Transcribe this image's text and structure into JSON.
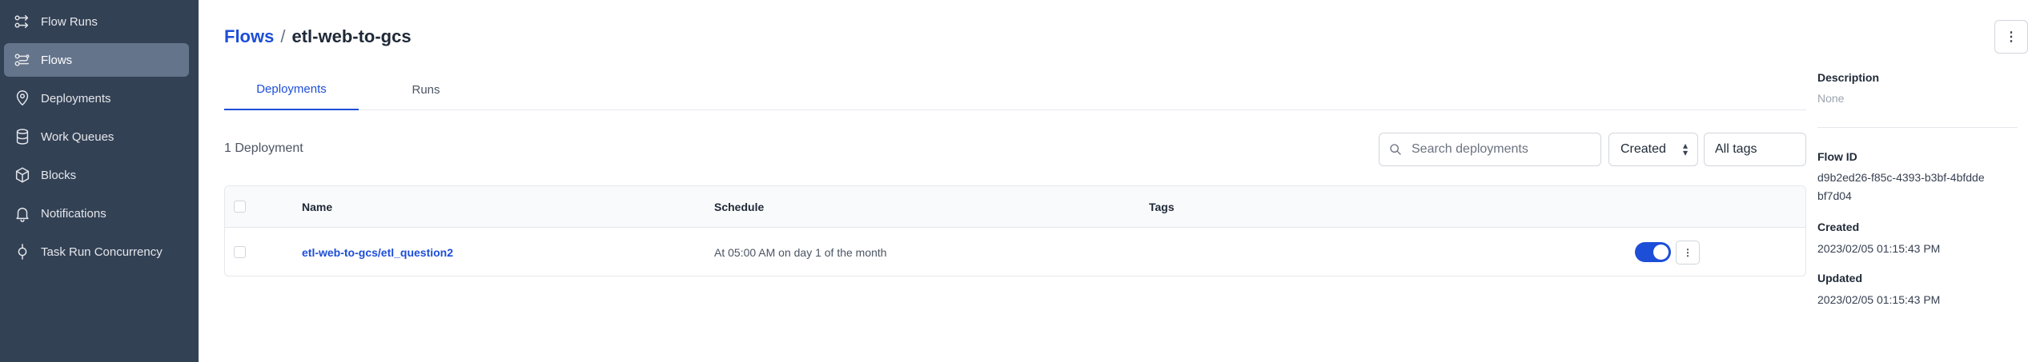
{
  "sidebar": {
    "items": [
      {
        "label": "Flow Runs",
        "icon": "flow-runs-icon",
        "active": false
      },
      {
        "label": "Flows",
        "icon": "flows-icon",
        "active": true
      },
      {
        "label": "Deployments",
        "icon": "map-pin-icon",
        "active": false
      },
      {
        "label": "Work Queues",
        "icon": "database-icon",
        "active": false
      },
      {
        "label": "Blocks",
        "icon": "cube-icon",
        "active": false
      },
      {
        "label": "Notifications",
        "icon": "bell-icon",
        "active": false
      },
      {
        "label": "Task Run Concurrency",
        "icon": "concurrency-icon",
        "active": false
      }
    ]
  },
  "header": {
    "breadcrumb_root": "Flows",
    "separator": "/",
    "flow_name": "etl-web-to-gcs"
  },
  "tabs": [
    {
      "label": "Deployments",
      "active": true
    },
    {
      "label": "Runs",
      "active": false
    }
  ],
  "deployments": {
    "count_label": "1 Deployment",
    "search_placeholder": "Search deployments",
    "sort_value": "Created",
    "tags_value": "All tags",
    "columns": [
      "Name",
      "Schedule",
      "Tags"
    ],
    "rows": [
      {
        "name_prefix": "etl-web-to-gcs/",
        "name": "etl_question2",
        "schedule": "At 05:00 AM on day 1 of the month",
        "tags": "",
        "active": true
      }
    ]
  },
  "details": {
    "description_label": "Description",
    "description_value": "None",
    "flow_id_label": "Flow ID",
    "flow_id_value": "d9b2ed26-f85c-4393-b3bf-4bfddebf7d04",
    "created_label": "Created",
    "created_value": "2023/02/05 01:15:43 PM",
    "updated_label": "Updated",
    "updated_value": "2023/02/05 01:15:43 PM"
  },
  "colors": {
    "sidebar_bg": "#334155",
    "sidebar_active": "#64748b",
    "accent": "#1d4ed8"
  }
}
